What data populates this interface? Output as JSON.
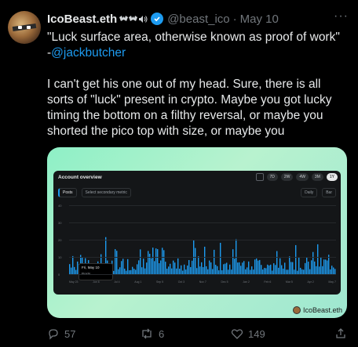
{
  "tweet": {
    "display_name": "IcoBeast.eth",
    "handle": "@beast_ico",
    "date": "May 10",
    "separator": "·",
    "quote": "\"Luck surface area, otherwise known as proof of work\"",
    "attribution_prefix": "-",
    "attribution_link": "@jackbutcher",
    "body": "I can't get his one out of my head. Sure, there is all sorts of \"luck\" present in crypto. Maybe you got lucky timing the bottom on a filthy reversal, or maybe you shorted the pico top with size, or maybe you",
    "more_icon": "ellipsis-icon"
  },
  "media": {
    "panel_title": "Account overview",
    "ranges": [
      "7D",
      "2W",
      "4W",
      "3M",
      "1Y"
    ],
    "active_range": "1Y",
    "metric": "Posts",
    "secondary_placeholder": "Select secondary metric",
    "interval": "Daily",
    "chart_type": "Bar",
    "tooltip_date": "Fri, May 10",
    "tooltip_metric": "Posts",
    "watermark": "IcoBeast.eth",
    "accent": "#1d9bf0",
    "y_ticks": [
      "40",
      "30",
      "20",
      "10",
      "0"
    ],
    "x_ticks": [
      "May 23",
      "Jun 6",
      "Jul 4",
      "Aug 1",
      "Sep 5",
      "Oct 3",
      "Nov 7",
      "Dec 5",
      "Jan 2",
      "Feb 6",
      "Mar 5",
      "Apr 2",
      "May 7"
    ]
  },
  "actions": {
    "replies": "57",
    "reposts": "6",
    "likes": "149"
  }
}
